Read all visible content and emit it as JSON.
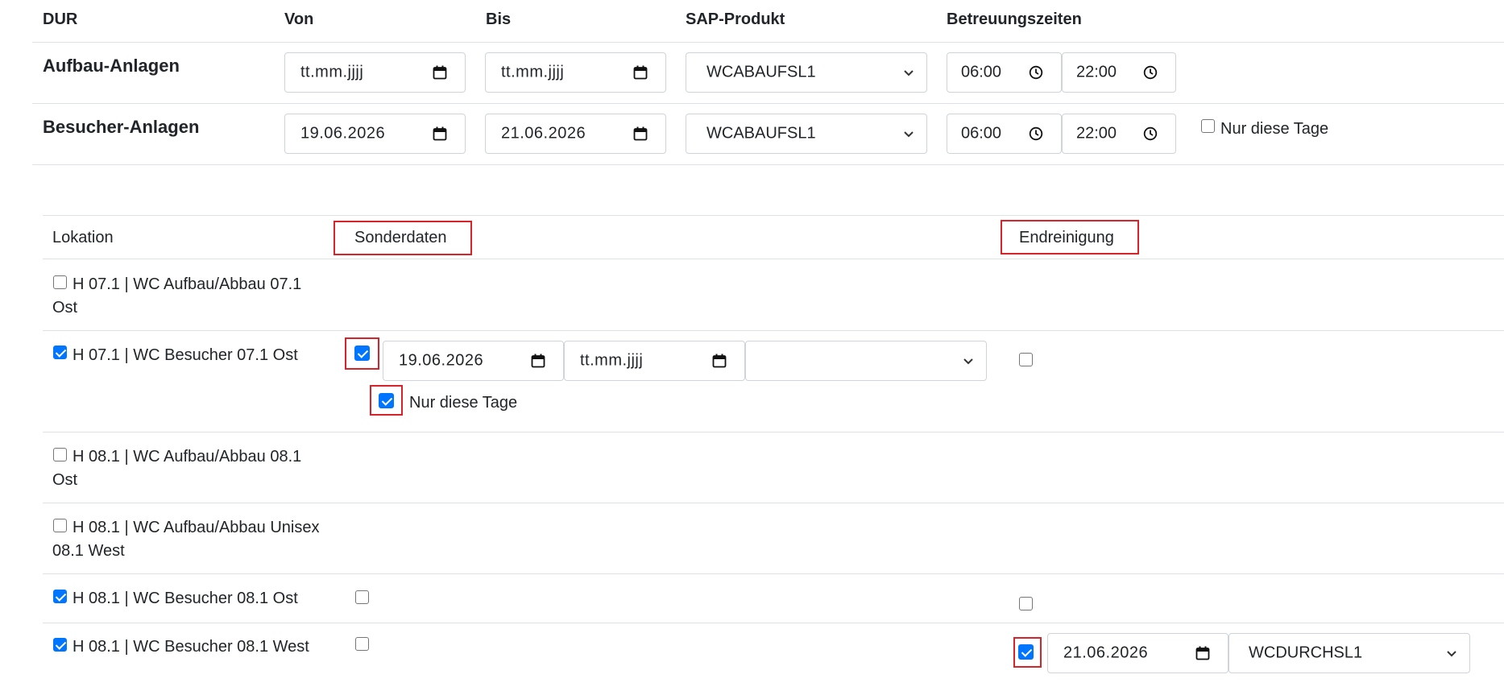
{
  "header": {
    "dur": "DUR",
    "von": "Von",
    "bis": "Bis",
    "sap_produkt": "SAP-Produkt",
    "betreuungszeiten": "Betreuungszeiten"
  },
  "rows": [
    {
      "label": "Aufbau-Anlagen",
      "von": "tt.mm.jjjj",
      "bis": "tt.mm.jjjj",
      "produkt": "WCABAUFSL1",
      "time_from": "06:00",
      "time_to": "22:00"
    },
    {
      "label": "Besucher-Anlagen",
      "von": "19.06.2026",
      "bis": "21.06.2026",
      "produkt": "WCABAUFSL1",
      "time_from": "06:00",
      "time_to": "22:00",
      "nur_diese_tage_label": "Nur diese Tage",
      "nur_diese_tage_checked": false
    }
  ],
  "table": {
    "col_lokation": "Lokation",
    "col_sonderdaten": "Sonderdaten",
    "col_endreinigung": "Endreinigung",
    "items": [
      {
        "label_line1": "H 07.1 | WC Aufbau/Abbau 07.1",
        "label_line2": "Ost",
        "checked": false
      },
      {
        "label_line1": "H 07.1 | WC Besucher 07.1 Ost",
        "checked": true,
        "sonder_checked": true,
        "sonder_von": "19.06.2026",
        "sonder_bis": "tt.mm.jjjj",
        "sonder_produkt": "",
        "nur_diese_tage_label": "Nur diese Tage",
        "nur_diese_tage_checked": true,
        "end_checked": false
      },
      {
        "label_line1": "H 08.1 | WC Aufbau/Abbau 08.1",
        "label_line2": "Ost",
        "checked": false
      },
      {
        "label_line1": "H 08.1 | WC Aufbau/Abbau Unisex",
        "label_line2": "08.1 West",
        "checked": false
      },
      {
        "label_line1": "H 08.1 | WC Besucher 08.1 Ost",
        "checked": true,
        "sonder_checked": false,
        "end_checked": false
      },
      {
        "label_line1": "H 08.1 | WC Besucher 08.1 West",
        "checked": true,
        "sonder_checked": false,
        "end_checked": true,
        "end_date": "21.06.2026",
        "end_produkt": "WCDURCHSL1"
      }
    ]
  },
  "colors": {
    "accent": "#0075ff",
    "highlight": "#d9232b",
    "border": "#ced4da",
    "divider": "#dee2e6"
  }
}
